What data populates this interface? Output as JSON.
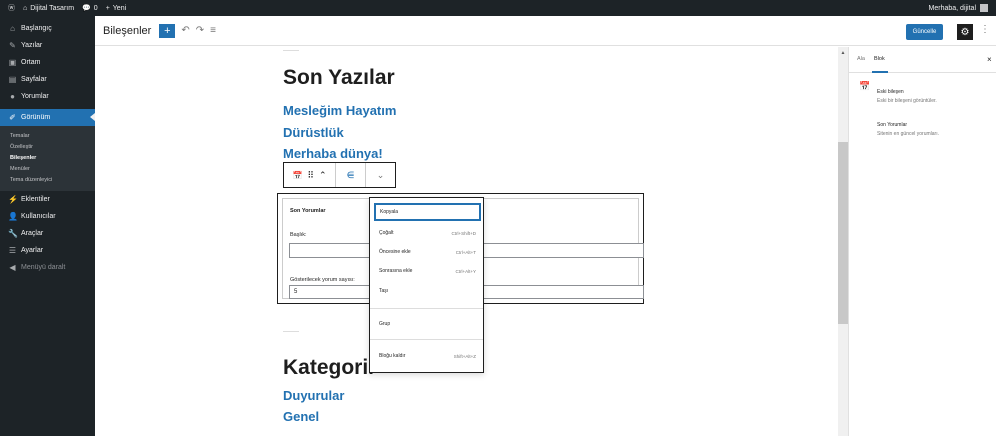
{
  "adminbar": {
    "wp_logo": "wordpress-icon",
    "site_name": "Dijital Tasarım",
    "comments_count": "0",
    "new_label": "Yeni",
    "greeting": "Merhaba, dijital"
  },
  "sidebar": {
    "items": [
      {
        "label": "Başlangıç",
        "icon": "dashboard-icon"
      },
      {
        "label": "Yazılar",
        "icon": "pin-icon"
      },
      {
        "label": "Ortam",
        "icon": "media-icon"
      },
      {
        "label": "Sayfalar",
        "icon": "page-icon"
      },
      {
        "label": "Yorumlar",
        "icon": "comment-icon"
      }
    ],
    "active": {
      "label": "Görünüm",
      "icon": "brush-icon"
    },
    "submenu": [
      "Temalar",
      "Özelleştir",
      "Bileşenler",
      "Menüler",
      "Tema düzenleyici"
    ],
    "items_after": [
      {
        "label": "Eklentiler",
        "icon": "plugin-icon"
      },
      {
        "label": "Kullanıcılar",
        "icon": "user-icon"
      },
      {
        "label": "Araçlar",
        "icon": "tool-icon"
      },
      {
        "label": "Ayarlar",
        "icon": "settings-icon"
      }
    ],
    "collapse_label": "Menüyü daralt"
  },
  "toolbar": {
    "title": "Bileşenler",
    "add_label": "+",
    "undo": "↶",
    "redo": "↷",
    "list": "≡",
    "update_label": "Güncelle",
    "settings_glyph": "⚙",
    "more_glyph": "⋮"
  },
  "canvas": {
    "heading1": "Son Yazılar",
    "links": [
      "Mesleğim Hayatım",
      "Dürüstlük",
      "Merhaba dünya!"
    ],
    "heading2": "Kategoril",
    "links2": [
      "Duyurular",
      "Genel"
    ]
  },
  "block_toolbar": {
    "calendar": "📅",
    "drag": "⠿",
    "updown": "⌃",
    "align": "⋹",
    "chevron": "⌄"
  },
  "widget": {
    "title": "Son Yorumlar",
    "title_field_label": "Başlık:",
    "title_field_value": "",
    "count_label": "Gösterilecek yorum sayısı:",
    "count_value": "5"
  },
  "dropdown": {
    "items": [
      {
        "label": "Kopyala",
        "shortcut": ""
      },
      {
        "label": "Çoğalt",
        "shortcut": "Ctrl+Shift+D"
      },
      {
        "label": "Öncesine ekle",
        "shortcut": "Ctrl+Alt+T"
      },
      {
        "label": "Sonrasına ekle",
        "shortcut": "Ctrl+Alt+Y"
      },
      {
        "label": "Taşı",
        "shortcut": ""
      },
      {
        "label": "Grup",
        "shortcut": ""
      },
      {
        "label": "Bloğu kaldır",
        "shortcut": "Shift+Alt+Z"
      }
    ]
  },
  "settings": {
    "tabs": [
      "Ala",
      "Blok"
    ],
    "close": "×",
    "block_title": "Eski bileşen",
    "block_desc": "Eski bir bileşeni görüntüler.",
    "widget_name": "Son Yorumlar",
    "widget_desc": "Sitenin en güncel yorumları."
  },
  "colors": {
    "admin_dark": "#1d2327",
    "accent": "#2271b1",
    "link": "#2271b1"
  }
}
